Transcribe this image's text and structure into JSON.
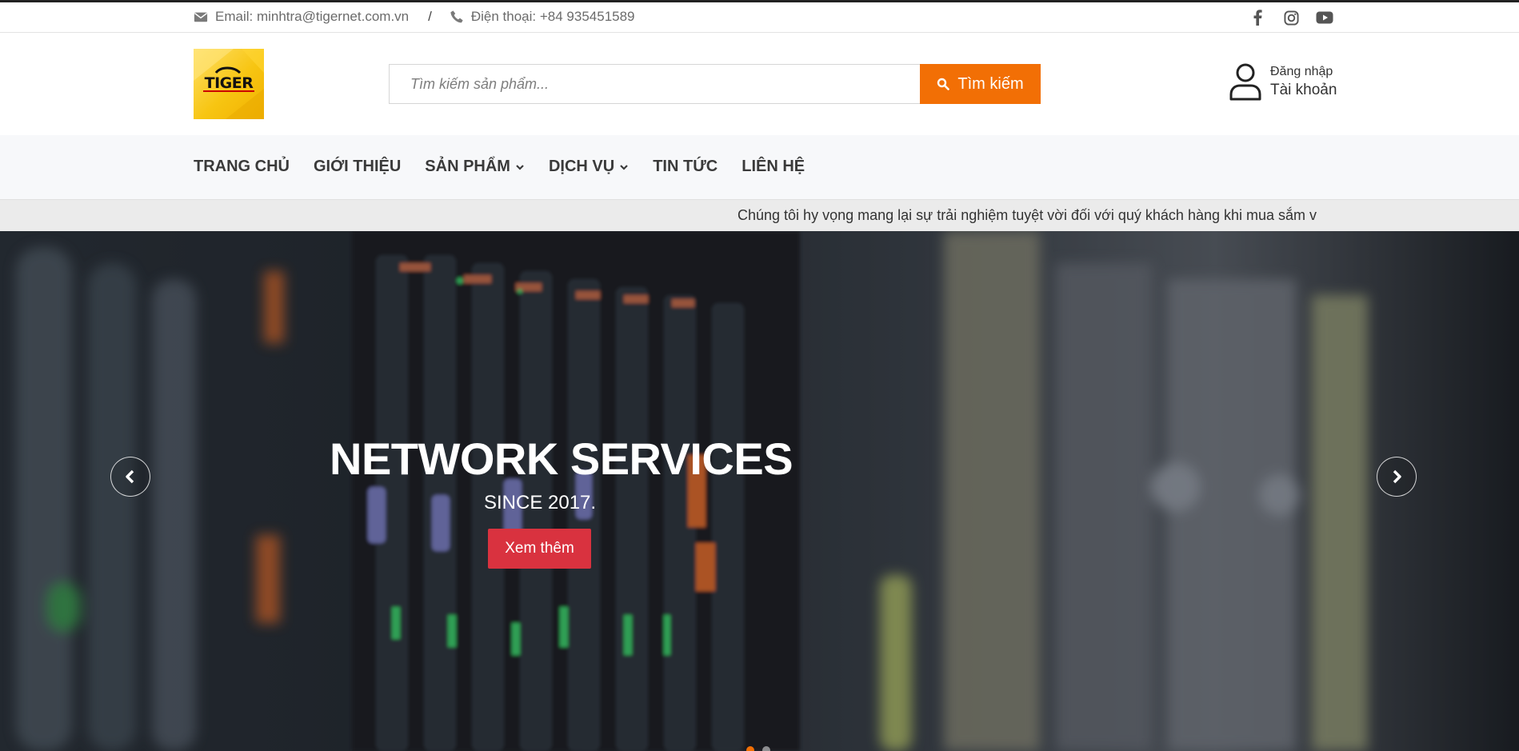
{
  "topbar": {
    "email": "Email: minhtra@tigernet.com.vn",
    "separator": "/",
    "phone": "Điện thoại: +84 935451589",
    "social": [
      "facebook-icon",
      "instagram-icon",
      "youtube-icon"
    ]
  },
  "header": {
    "logo_text": "TIGER",
    "search_placeholder": "Tìm kiếm sản phẩm...",
    "search_button": "Tìm kiếm",
    "account_login": "Đăng nhập",
    "account_label": "Tài khoản"
  },
  "nav": {
    "items": [
      {
        "label": "TRANG CHỦ",
        "dropdown": false
      },
      {
        "label": "GIỚI THIỆU",
        "dropdown": false
      },
      {
        "label": "SẢN PHẨM",
        "dropdown": true
      },
      {
        "label": "DỊCH VỤ",
        "dropdown": true
      },
      {
        "label": "TIN TỨC",
        "dropdown": false
      },
      {
        "label": "LIÊN HỆ",
        "dropdown": false
      }
    ]
  },
  "marquee": {
    "text": "Chúng tôi hy vọng mang lại sự trải nghiệm tuyệt vời đối với quý khách hàng khi mua sắm v"
  },
  "hero": {
    "title": "NETWORK SERVICES",
    "subtitle": "SINCE 2017.",
    "button": "Xem thêm"
  },
  "colors": {
    "accent": "#f26f05",
    "hero_button": "#d9323f",
    "nav_bg": "#f7f8fa",
    "marquee_bg": "#ebebeb",
    "logo_yellow": "#f7c512"
  }
}
